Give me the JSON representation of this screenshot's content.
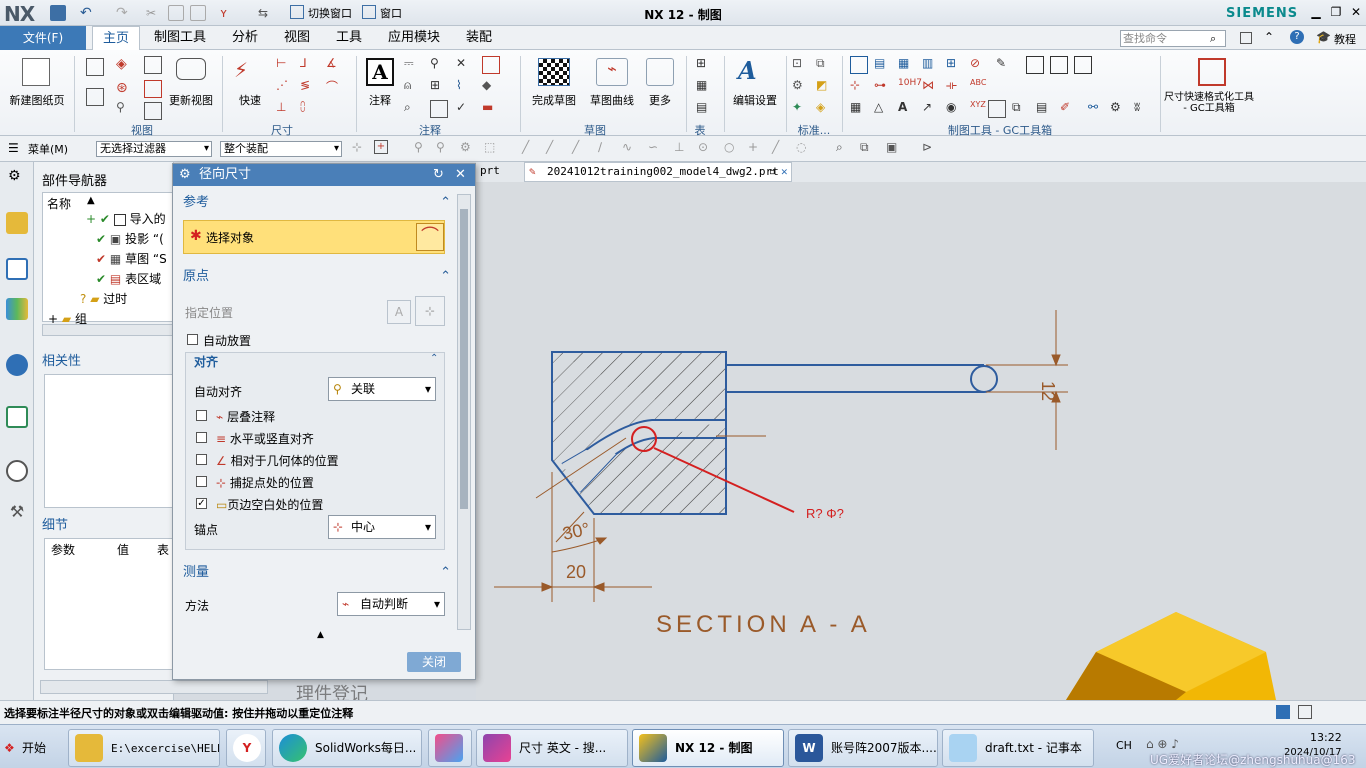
{
  "app": {
    "logo": "NX",
    "title": "NX 12 - 制图",
    "brand": "SIEMENS"
  },
  "quick_access": {
    "switch_window": "切换窗口",
    "window": "窗口"
  },
  "menubar": {
    "file": "文件(F)",
    "tabs": [
      "主页",
      "制图工具",
      "分析",
      "视图",
      "工具",
      "应用模块",
      "装配"
    ],
    "search_placeholder": "查找命令",
    "tutorial": "教程"
  },
  "ribbon": {
    "new_sheet": "新建图纸页",
    "update_view": "更新视图",
    "group_view": "视图",
    "quick": "快速",
    "group_dimension": "尺寸",
    "note": "注释",
    "group_annotation": "注释",
    "finish_sketch": "完成草图",
    "sketch_curve": "草图曲线",
    "more": "更多",
    "group_sketch": "草图",
    "group_table": "表",
    "edit_settings": "编辑设置",
    "group_standard": "标准...",
    "group_drafting_tools": "制图工具 - GC工具箱",
    "dim_quick_format": "尺寸快速格式化工具 - GC工具箱"
  },
  "secondary": {
    "menu": "菜单(M)",
    "filter": "无选择过滤器",
    "assembly": "整个装配"
  },
  "navigator": {
    "title": "部件导航器",
    "col_name": "名称",
    "items": [
      "导入的",
      "投影 “(",
      "草图 “S",
      "表区域",
      "过时",
      "组"
    ],
    "related_title": "相关性",
    "details_title": "细节",
    "detail_cols": [
      "参数",
      "值",
      "表"
    ]
  },
  "dialog": {
    "title": "径向尺寸",
    "ref_section": "参考",
    "select_object": "选择对象",
    "origin_section": "原点",
    "specify_location": "指定位置",
    "auto_place": "自动放置",
    "align_section": "对齐",
    "auto_align": "自动对齐",
    "auto_align_value": "关联",
    "options": [
      {
        "label": "层叠注释",
        "checked": false
      },
      {
        "label": "水平或竖直对齐",
        "checked": false
      },
      {
        "label": "相对于几何体的位置",
        "checked": false
      },
      {
        "label": "捕捉点处的位置",
        "checked": false
      },
      {
        "label": "页边空白处的位置",
        "checked": true
      }
    ],
    "anchor": "锚点",
    "anchor_value": "中心",
    "measure_section": "测量",
    "method": "方法",
    "method_value": "自动判断",
    "close": "关闭"
  },
  "tabs": {
    "prev_tab": "prt",
    "active_tab": "20241012training002_model4_dwg2.prt"
  },
  "drawing": {
    "dim_12": "12",
    "dim_30": "30°",
    "dim_20": "20",
    "radius_label": "R?  Φ?",
    "section_label": "SECTION  A - A",
    "background_text": "理件登记"
  },
  "status": {
    "message": "选择要标注半径尺寸的对象或双击编辑驱动值: 按住并拖动以重定位注释"
  },
  "taskbar": {
    "start": "开始",
    "items": [
      "E:\\excercise\\HELP",
      "SolidWorks每日...",
      "尺寸 英文 - 搜...",
      "NX 12 - 制图",
      "账号阵2007版本....",
      "draft.txt - 记事本"
    ],
    "lang": "CH",
    "time": "13:22",
    "date": "2024/10/17",
    "watermark": "UG爱好者论坛@zhengshuhua@163"
  },
  "colors": {
    "accent": "#3c79b7",
    "dialog_title": "#4a7fb8",
    "drawing_blue": "#2e5c9e",
    "dim_brown": "#9a5a2a",
    "highlight_red": "#d42020",
    "select_yellow": "#ffe07a"
  }
}
